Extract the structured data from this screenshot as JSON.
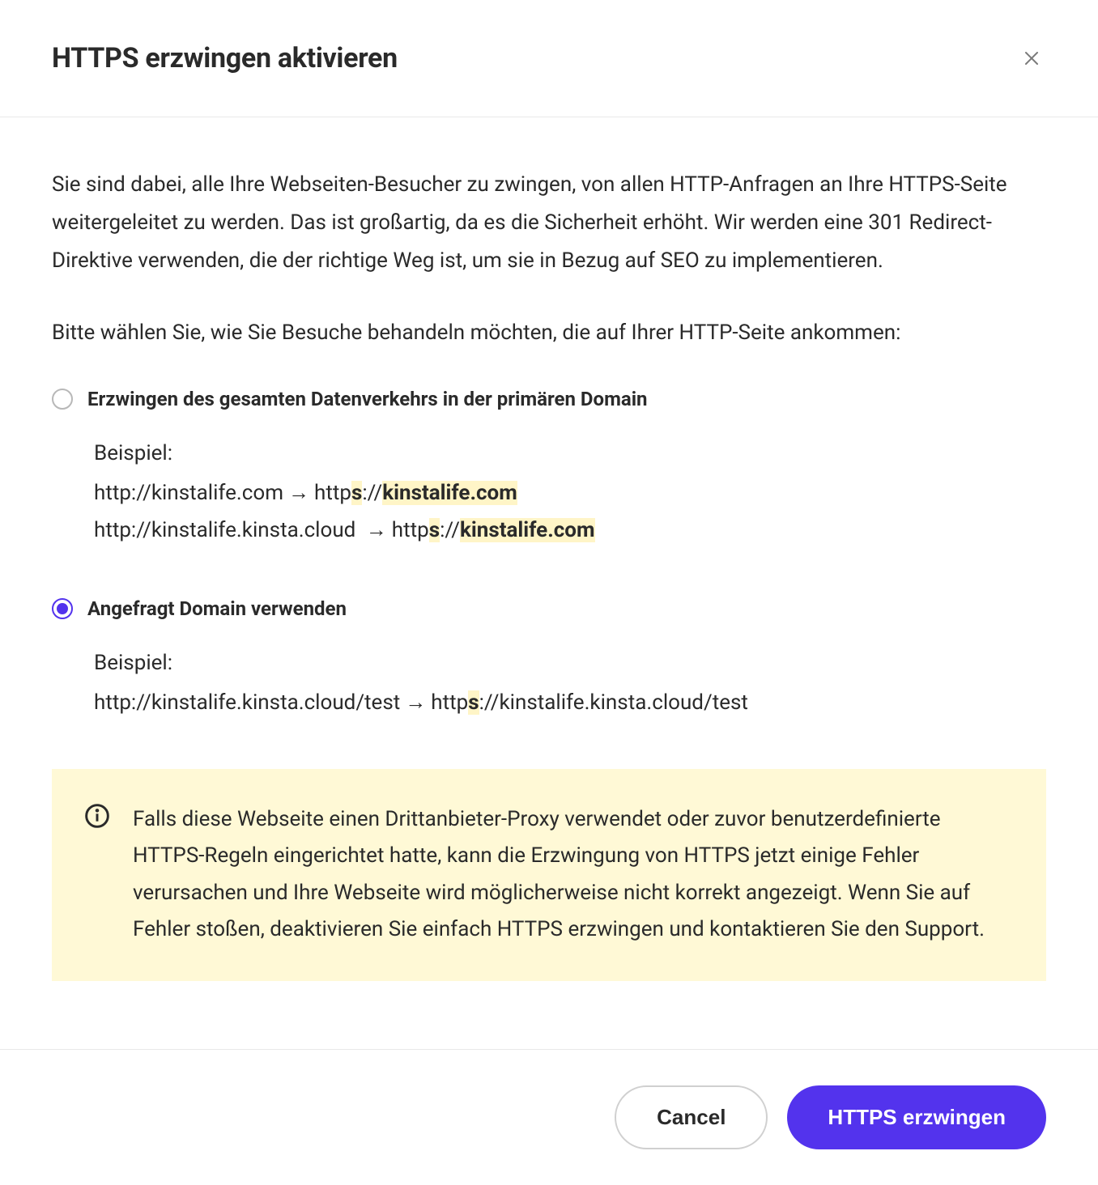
{
  "header": {
    "title": "HTTPS erzwingen aktivieren"
  },
  "body": {
    "intro": "Sie sind dabei, alle Ihre Webseiten-Besucher zu zwingen, von allen HTTP-Anfragen an Ihre HTTPS-Seite weitergeleitet zu werden. Das ist großartig, da es die Sicherheit erhöht. Wir werden eine 301 Redirect-Direktive verwenden, die der richtige Weg ist, um sie in Bezug auf SEO zu implementieren.",
    "prompt": "Bitte wählen Sie, wie Sie Besuche behandeln möchten, die auf Ihrer HTTP-Seite ankommen:",
    "options": {
      "option1": {
        "label": "Erzwingen des gesamten Datenverkehrs in der primären Domain",
        "selected": false,
        "example_label": "Beispiel:",
        "line1_from": "http://kinstalife.com",
        "line1_to_prefix": "http",
        "line1_to_s": "s",
        "line1_to_sep": "://",
        "line1_to_domain": "kinstalife.com",
        "line2_from": "http://kinstalife.kinsta.cloud ",
        "line2_to_prefix": "http",
        "line2_to_s": "s",
        "line2_to_sep": "://",
        "line2_to_domain": "kinstalife.com"
      },
      "option2": {
        "label": "Angefragt Domain verwenden",
        "selected": true,
        "example_label": "Beispiel:",
        "line1_from": "http://kinstalife.kinsta.cloud/test",
        "line1_to_prefix": "http",
        "line1_to_s": "s",
        "line1_to_rest": "://kinstalife.kinsta.cloud/test"
      }
    },
    "info": "Falls diese Webseite einen Drittanbieter-Proxy verwendet oder zuvor benutzerdefinierte HTTPS-Regeln eingerichtet hatte, kann die Erzwingung von HTTPS jetzt einige Fehler verursachen und Ihre Webseite wird möglicherweise nicht korrekt angezeigt. Wenn Sie auf Fehler stoßen, deaktivieren Sie einfach HTTPS erzwingen und kontaktieren Sie den Support."
  },
  "footer": {
    "cancel": "Cancel",
    "confirm": "HTTPS erzwingen"
  },
  "arrow": "→"
}
